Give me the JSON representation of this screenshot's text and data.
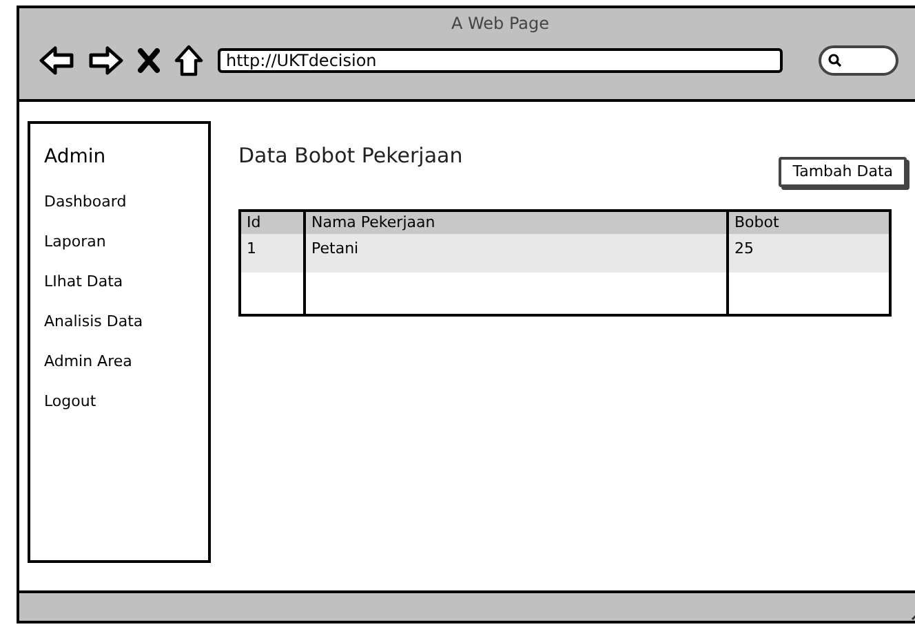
{
  "window": {
    "title": "A Web Page",
    "url": "http://UKTdecision"
  },
  "sidebar": {
    "title": "Admin",
    "items": [
      {
        "label": "Dashboard"
      },
      {
        "label": "Laporan"
      },
      {
        "label": "LIhat Data"
      },
      {
        "label": "Analisis Data"
      },
      {
        "label": "Admin Area"
      },
      {
        "label": "Logout"
      }
    ]
  },
  "page": {
    "title": "Data Bobot Pekerjaan",
    "add_button": "Tambah Data"
  },
  "table": {
    "columns": [
      "Id",
      "Nama Pekerjaan",
      "Bobot"
    ],
    "rows": [
      [
        "1",
        "Petani",
        "25"
      ]
    ]
  }
}
